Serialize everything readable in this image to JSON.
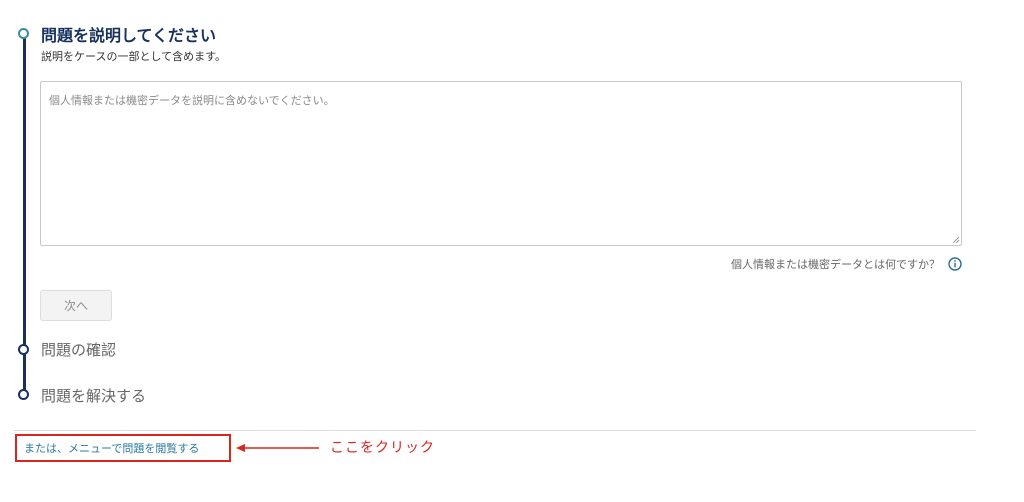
{
  "stepper": {
    "step1": {
      "title": "問題を説明してください",
      "subtitle": "説明をケースの一部として含めます。"
    },
    "description_field": {
      "value": "",
      "placeholder": "個人情報または機密データを説明に含めないでください。"
    },
    "help_text": "個人情報または機密データとは何ですか？",
    "next_button": "次へ",
    "step2": {
      "title": "問題の確認"
    },
    "step3": {
      "title": "問題を解決する"
    }
  },
  "footer": {
    "browse_link": "または、メニューで問題を閲覧する",
    "annotation": "ここをクリック"
  },
  "colors": {
    "primary": "#16325c",
    "active_dot": "#3a8ea3",
    "link": "#2c7a9b",
    "annotation_red": "#d9261c"
  },
  "icons": {
    "info": "info-circle-icon",
    "arrow": "left-arrow-icon"
  }
}
